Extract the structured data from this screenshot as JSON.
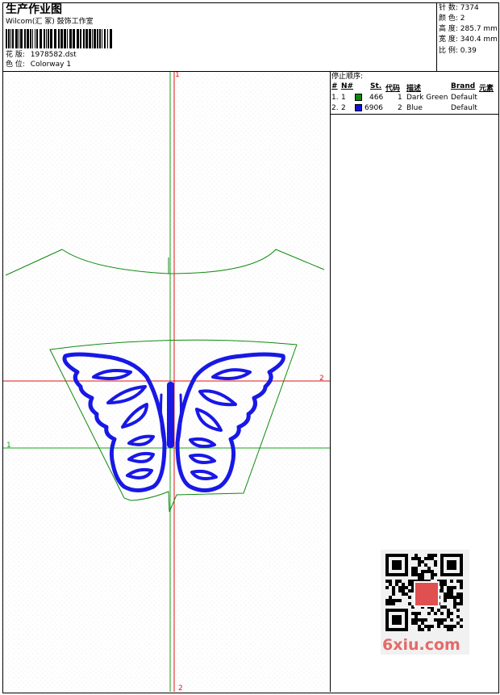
{
  "header": {
    "title": "生产作业图",
    "company": "Wilcom(汇 冢) 鼓饰工作室",
    "design_label": "花 版:",
    "design_file": "1978582.dst",
    "colorway_label": "色 位:",
    "colorway": "Colorway 1"
  },
  "stats": [
    {
      "label": "针 数:",
      "value": "7374"
    },
    {
      "label": "颜 色:",
      "value": "2"
    },
    {
      "label": "高 度:",
      "value": "285.7 mm"
    },
    {
      "label": "宽 度:",
      "value": "340.4 mm"
    },
    {
      "label": "比 例:",
      "value": "0.39"
    }
  ],
  "stop_sequence": {
    "title": "停止顺序:",
    "columns": [
      "#",
      "N#",
      "St.",
      "代码",
      "描述",
      "Brand",
      "元素"
    ],
    "rows": [
      {
        "index": "1.",
        "n": "1",
        "stitches": "466",
        "code": "1",
        "description": "Dark Green",
        "brand": "Default",
        "color": "#0b8a0b"
      },
      {
        "index": "2.",
        "n": "2",
        "stitches": "6906",
        "code": "2",
        "description": "Blue",
        "brand": "Default",
        "color": "#1010e0"
      }
    ]
  },
  "canvas": {
    "axis_labels": {
      "top": "1",
      "right": "2",
      "left": "1",
      "bottom": "2"
    },
    "colors": {
      "guide_green": "#16a016",
      "guide_red": "#e01616",
      "stitch_blue": "#1818e6",
      "outline_green": "#0e8a0e"
    }
  },
  "watermark": "6xiu.com"
}
